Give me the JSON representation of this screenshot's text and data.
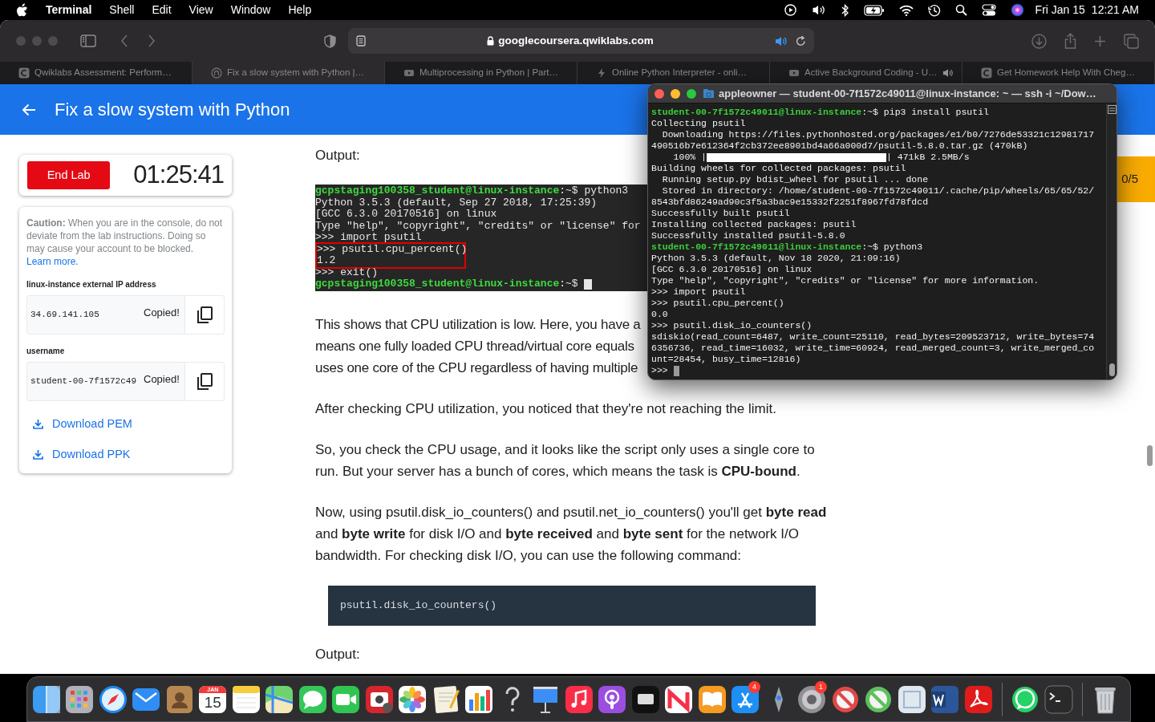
{
  "menubar": {
    "app": "Terminal",
    "menus": [
      "Shell",
      "Edit",
      "View",
      "Window",
      "Help"
    ],
    "date": "Fri Jan 15",
    "time": "12:21 AM"
  },
  "browser": {
    "url": "googlecoursera.qwiklabs.com",
    "tabs": [
      {
        "title": "Qwiklabs Assessment: Perform…",
        "selected": false
      },
      {
        "title": "Fix a slow system with Python |…",
        "selected": true
      },
      {
        "title": "Multiprocessing in Python | Part…",
        "selected": false
      },
      {
        "title": "Online Python Interpreter - onli…",
        "selected": false
      },
      {
        "title": "Active Background Coding - U…",
        "selected": false,
        "playing": true
      },
      {
        "title": "Get Homework Help With Cheg…",
        "selected": false
      }
    ]
  },
  "page": {
    "title": "Fix a slow system with Python",
    "end_lab": "End Lab",
    "timer": "01:25:41",
    "score": "0/5",
    "caution_label": "Caution:",
    "caution_text": " When you are in the console, do not deviate from the lab instructions. Doing so may cause your account to be blocked.",
    "learn_more": "Learn more.",
    "fields": [
      {
        "label": "linux-instance external IP address",
        "value": "34.69.141.105",
        "status": "Copied!"
      },
      {
        "label": "username",
        "value": "student-00-7f1572c49",
        "status": "Copied!"
      }
    ],
    "downloads": [
      "Download PEM",
      "Download PPK"
    ]
  },
  "article": [
    {
      "kind": "label",
      "text": "Output:"
    },
    {
      "kind": "console",
      "lines": [
        {
          "kind": "prompt",
          "user": "gcpstaging100358_student@linux-instance",
          "colon": ":",
          "path": "~",
          "command": "$ python3"
        },
        {
          "kind": "text",
          "text": "Python 3.5.3 (default, Sep 27 2018, 17:25:39)"
        },
        {
          "kind": "text",
          "text": "[GCC 6.3.0 20170516] on linux"
        },
        {
          "kind": "text",
          "text": "Type \"help\", \"copyright\", \"credits\" or \"license\" for"
        },
        {
          "kind": "text",
          "text": ">>> import psutil"
        },
        {
          "kind": "text",
          "text": ">>> psutil.cpu_percent()",
          "highlighted": true
        },
        {
          "kind": "text",
          "text": "1.2",
          "highlighted": true
        },
        {
          "kind": "text",
          "text": ">>> exit()"
        },
        {
          "kind": "prompt",
          "user": "gcpstaging100358_student@linux-instance",
          "colon": ":",
          "path": "~",
          "command": "$ ",
          "cursor": true
        }
      ]
    },
    {
      "kind": "lines",
      "lines": [
        "This shows that CPU utilization is low. Here, you have a",
        "means one fully loaded CPU thread/virtual core equals",
        "uses one core of the CPU regardless of having multiple"
      ]
    },
    {
      "kind": "paragraph",
      "text": "After checking CPU utilization, you noticed that they're not reaching the limit."
    },
    {
      "kind": "paragraph",
      "text": "So, you check the CPU usage, and it looks like the script only uses a single core to run. But your server has a bunch of cores, which means the task is **CPU-bound**."
    },
    {
      "kind": "paragraph",
      "text": "Now, using psutil.disk_io_counters() and psutil.net_io_counters() you'll get **byte read** and **byte write** for disk I/O and **byte received** and **byte sent** for the network I/O bandwidth. For checking disk I/O, you can use the following command:"
    },
    {
      "kind": "code",
      "text": "psutil.disk_io_counters()"
    },
    {
      "kind": "label",
      "text": "Output:"
    }
  ],
  "terminal": {
    "title": "appleowner — student-00-7f1572c49011@linux-instance: ~ — ssh -i ~/Dow…",
    "lines": [
      {
        "kind": "prompt",
        "user": "student-00-7f1572c49011@linux-instance",
        "colon": ":",
        "path": "~",
        "command": "$ pip3 install psutil"
      },
      {
        "kind": "text",
        "text": "Collecting psutil"
      },
      {
        "kind": "text",
        "text": "  Downloading https://files.pythonhosted.org/packages/e1/b0/7276de53321c12981717"
      },
      {
        "kind": "text",
        "text": "490516b7e612364f2cb372ee8901bd4a66a000d7/psutil-5.8.0.tar.gz (470kB)"
      },
      {
        "kind": "progress",
        "prefix": "    100% |",
        "level": 1,
        "suffix": "| 471kB 2.5MB/s"
      },
      {
        "kind": "text",
        "text": "Building wheels for collected packages: psutil"
      },
      {
        "kind": "text",
        "text": "  Running setup.py bdist_wheel for psutil ... done"
      },
      {
        "kind": "text",
        "text": "  Stored in directory: /home/student-00-7f1572c49011/.cache/pip/wheels/65/65/52/"
      },
      {
        "kind": "text",
        "text": "8543bfd86249ad90c3f5a3bac9e15332f2251f8967fd78fdcd"
      },
      {
        "kind": "text",
        "text": "Successfully built psutil"
      },
      {
        "kind": "text",
        "text": "Installing collected packages: psutil"
      },
      {
        "kind": "text",
        "text": "Successfully installed psutil-5.8.0"
      },
      {
        "kind": "prompt",
        "user": "student-00-7f1572c49011@linux-instance",
        "colon": ":",
        "path": "~",
        "command": "$ python3"
      },
      {
        "kind": "text",
        "text": "Python 3.5.3 (default, Nov 18 2020, 21:09:16)"
      },
      {
        "kind": "text",
        "text": "[GCC 6.3.0 20170516] on linux"
      },
      {
        "kind": "text",
        "text": "Type \"help\", \"copyright\", \"credits\" or \"license\" for more information."
      },
      {
        "kind": "text",
        "text": ">>> import psutil"
      },
      {
        "kind": "text",
        "text": ">>> psutil.cpu_percent()"
      },
      {
        "kind": "text",
        "text": "0.0"
      },
      {
        "kind": "text",
        "text": ">>> psutil.disk_io_counters()"
      },
      {
        "kind": "text",
        "text": "sdiskio(read_count=6487, write_count=25110, read_bytes=209523712, write_bytes=74"
      },
      {
        "kind": "text",
        "text": "6356736, read_time=16032, write_time=60924, read_merged_count=3, write_merged_co"
      },
      {
        "kind": "text",
        "text": "unt=28454, busy_time=12816)"
      },
      {
        "kind": "text",
        "text": ">>> ",
        "cursor": true
      }
    ]
  },
  "dock": {
    "calendar_month": "JAN",
    "calendar_day": "15",
    "badges": [
      "4",
      "1"
    ]
  }
}
